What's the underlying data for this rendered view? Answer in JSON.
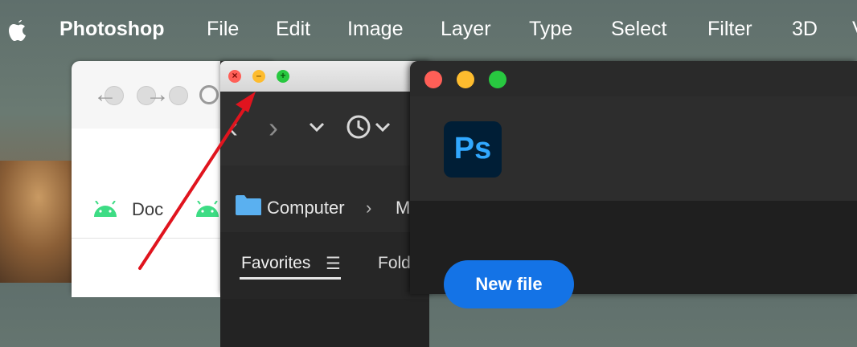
{
  "menubar": {
    "app_name": "Photoshop",
    "items": [
      "File",
      "Edit",
      "Image",
      "Layer",
      "Type",
      "Select",
      "Filter",
      "3D",
      "V"
    ]
  },
  "browser": {
    "bookmarks": [
      "Doc"
    ]
  },
  "finder": {
    "path": [
      "Computer",
      "M"
    ],
    "sidebar_tabs": [
      "Favorites",
      "Fold"
    ]
  },
  "photoshop": {
    "logo_text": "Ps",
    "new_file_label": "New file"
  },
  "colors": {
    "close": "#ff5f57",
    "minimize": "#febc2e",
    "zoom": "#28c840",
    "annotation_arrow": "#e0141e",
    "ps_blue": "#31a8ff",
    "ps_button": "#1473e6"
  }
}
